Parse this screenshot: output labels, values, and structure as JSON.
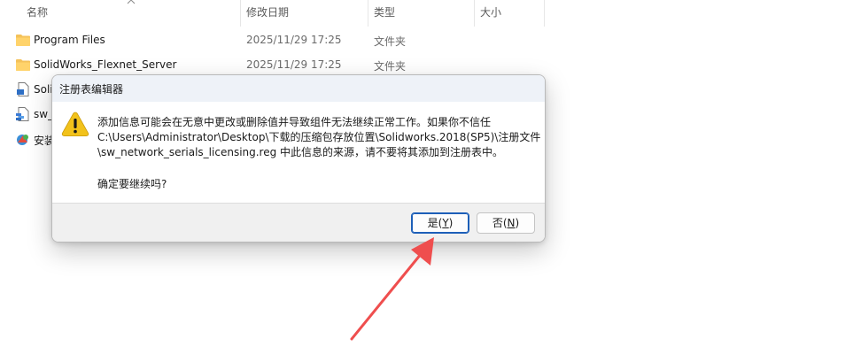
{
  "columns": {
    "name": "名称",
    "modified": "修改日期",
    "type": "类型",
    "size": "大小"
  },
  "files": [
    {
      "name": "Program Files",
      "date": "2025/11/29 17:25",
      "type": "文件夹",
      "icon": "folder-icon"
    },
    {
      "name": "SolidWorks_Flexnet_Server",
      "date": "2025/11/29 17:25",
      "type": "文件夹",
      "icon": "folder-icon"
    },
    {
      "name": "Soli",
      "date": "",
      "type": "",
      "icon": "file-icon"
    },
    {
      "name": "sw_",
      "date": "",
      "type": "",
      "icon": "reg-file-icon"
    },
    {
      "name": "安装",
      "date": "",
      "type": "",
      "icon": "installer-icon"
    }
  ],
  "dialog": {
    "title": "注册表编辑器",
    "message_lines": [
      "添加信息可能会在无意中更改或删除值并导致组件无法继续正常工作。如果你不信任",
      "C:\\Users\\Administrator\\Desktop\\下载的压缩包存放位置\\Solidworks.2018(SP5)\\注册文件",
      "\\sw_network_serials_licensing.reg 中此信息的来源，请不要将其添加到注册表中。"
    ],
    "question": "确定要继续吗?",
    "yes_text": "是(",
    "yes_key": "Y",
    "yes_end": ")",
    "no_text": "否(",
    "no_key": "N",
    "no_end": ")",
    "icon": "warning-icon"
  },
  "colors": {
    "accent": "#1d5fb8",
    "folder": "#f4c25a",
    "arrow": "#ef4e4e",
    "warning": "#f2c21b"
  }
}
